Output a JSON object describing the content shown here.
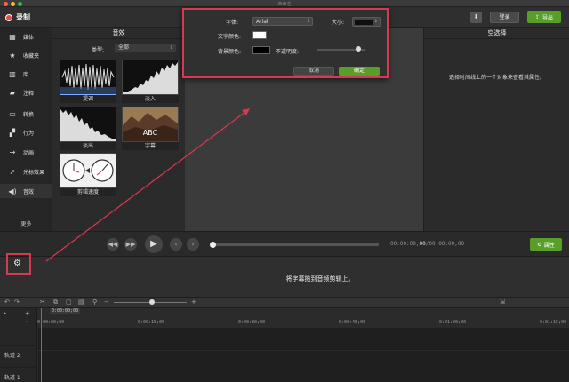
{
  "window": {
    "title": "未命名"
  },
  "topbar": {
    "record_label": "录制",
    "login_label": "登录",
    "export_label": "导出"
  },
  "sidebar": {
    "items": [
      {
        "label": "媒体",
        "icon": "film-icon"
      },
      {
        "label": "收藏夹",
        "icon": "star-icon"
      },
      {
        "label": "库",
        "icon": "library-icon"
      },
      {
        "label": "注释",
        "icon": "annotation-icon"
      },
      {
        "label": "转换",
        "icon": "transition-icon"
      },
      {
        "label": "行为",
        "icon": "behavior-icon"
      },
      {
        "label": "动画",
        "icon": "animation-icon"
      },
      {
        "label": "光标效果",
        "icon": "cursor-icon"
      },
      {
        "label": "音效",
        "icon": "speaker-icon"
      }
    ],
    "active": "音效",
    "more_label": "更多"
  },
  "library": {
    "title": "音效",
    "type_label": "类型:",
    "type_value": "全部",
    "items": [
      {
        "label": "提调"
      },
      {
        "label": "淡入"
      },
      {
        "label": "淡出"
      },
      {
        "label": "字幕",
        "thumb_text": "ABC"
      },
      {
        "label": "剪辑速度"
      }
    ]
  },
  "properties": {
    "title": "空选择",
    "message": "选择时间线上的一个对象来查看其属性。"
  },
  "popup": {
    "font_label": "字体:",
    "font_value": "Arial",
    "size_label": "大小:",
    "text_color_label": "文字颜色:",
    "bg_color_label": "背景颜色:",
    "opacity_label": "不透明度:",
    "opacity_value": 0.85,
    "text_color": "#ffffff",
    "bg_color": "#000000",
    "cancel_label": "取消",
    "ok_label": "确定"
  },
  "playback": {
    "timecode_pre": "00:00:00;",
    "timecode_cur": "00",
    "timecode_post": "/00:00:00;00",
    "attr_label": "属性",
    "progress": 0.0
  },
  "caption": {
    "message": "将字幕拖到音频剪辑上。"
  },
  "timeline": {
    "playhead_time": "0:00:00;00",
    "ruler": [
      "0:00:00;00",
      "0:00:15;00",
      "0:00:30;00",
      "0:00:45;00",
      "0:01:00;00",
      "0:01:15;00"
    ],
    "tracks": [
      "轨道 2",
      "轨道 1"
    ]
  },
  "colors": {
    "accent_green": "#5a9e2a",
    "highlight_red": "#d63a52",
    "record_red": "#e74a4a"
  }
}
